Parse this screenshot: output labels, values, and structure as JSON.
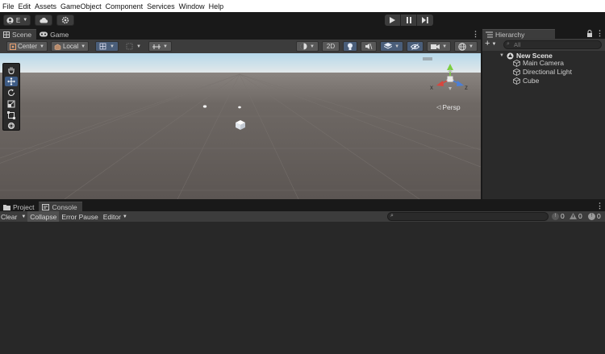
{
  "menu": [
    "File",
    "Edit",
    "Assets",
    "GameObject",
    "Component",
    "Services",
    "Window",
    "Help"
  ],
  "toolbar": {
    "account_label": "E",
    "account_icon": "account-icon",
    "cloud_icon": "cloud-icon",
    "settings_icon": "gear-icon",
    "play_icon": "play-icon",
    "pause_icon": "pause-icon",
    "step_icon": "step-icon"
  },
  "scene_tabs": {
    "scene": "Scene",
    "game": "Game"
  },
  "scene_toolbar": {
    "pivot": "Center",
    "space": "Local",
    "mode_2d": "2D",
    "persp_label": "Persp"
  },
  "gizmo": {
    "x": "x",
    "z": "z"
  },
  "hierarchy": {
    "title": "Hierarchy",
    "search_placeholder": "All",
    "scene_name": "New Scene",
    "items": [
      "Main Camera",
      "Directional Light",
      "Cube"
    ]
  },
  "bottom_tabs": {
    "project": "Project",
    "console": "Console"
  },
  "console": {
    "clear": "Clear",
    "collapse": "Collapse",
    "error_pause": "Error Pause",
    "editor": "Editor",
    "log_count": "0",
    "warning_count": "0",
    "error_count": "0"
  },
  "colors": {
    "menubar_bg": "#ffffff",
    "toolbar_bg": "#191919",
    "panel_bg": "#282828",
    "sky_top": "#8ec0d8",
    "ground": "#5f5b58",
    "accent_blue": "#3e5c86",
    "gizmo_red": "#d9453d",
    "gizmo_green": "#7bcf3f",
    "gizmo_blue": "#4a7fd9"
  }
}
